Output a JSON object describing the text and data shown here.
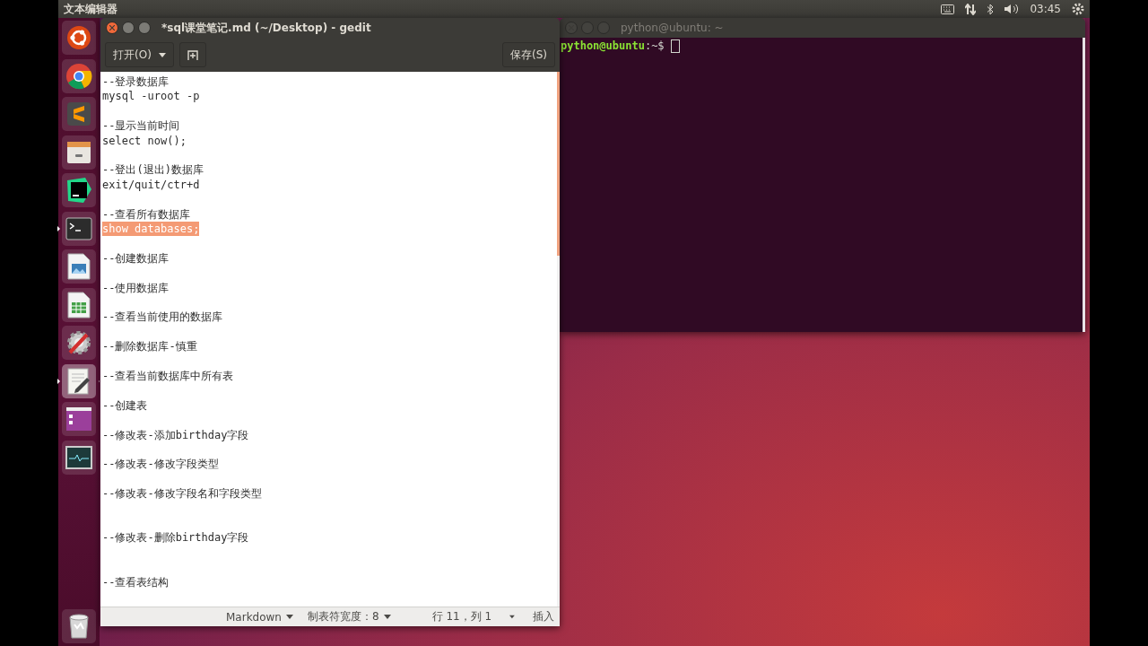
{
  "top_panel": {
    "app_title": "文本编辑器",
    "clock": "03:45"
  },
  "launcher": [
    {
      "kind": "ubuntu",
      "running": false,
      "focused": false
    },
    {
      "kind": "chrome",
      "running": false,
      "focused": false
    },
    {
      "kind": "sublime",
      "running": false,
      "focused": false
    },
    {
      "kind": "files",
      "running": false,
      "focused": false
    },
    {
      "kind": "pycharm",
      "running": false,
      "focused": false
    },
    {
      "kind": "terminal",
      "running": true,
      "focused": false
    },
    {
      "kind": "impress",
      "running": false,
      "focused": false
    },
    {
      "kind": "calc",
      "running": false,
      "focused": false
    },
    {
      "kind": "tools",
      "running": false,
      "focused": false
    },
    {
      "kind": "editor",
      "running": true,
      "focused": true
    },
    {
      "kind": "window",
      "running": false,
      "focused": false
    },
    {
      "kind": "monitor",
      "running": false,
      "focused": false
    },
    {
      "kind": "trash",
      "running": false,
      "focused": false
    }
  ],
  "editor_window": {
    "title": "*sql课堂笔记.md (~/Desktop) - gedit",
    "focused": true,
    "toolbar": {
      "open_button": "打开(O)",
      "save_button": "保存(S)"
    },
    "paragraphs": [
      {
        "spaced": false,
        "lines": [
          {
            "text": "--登录数据库",
            "selected": false
          },
          {
            "text": "mysql -uroot -p",
            "selected": false
          }
        ]
      },
      {
        "spaced": false,
        "lines": [
          {
            "text": "--显示当前时间",
            "selected": false
          },
          {
            "text": "select now();",
            "selected": false
          }
        ]
      },
      {
        "spaced": false,
        "lines": [
          {
            "text": "--登出(退出)数据库",
            "selected": false
          },
          {
            "text": "exit/quit/ctr+d",
            "selected": false
          }
        ]
      },
      {
        "spaced": false,
        "lines": [
          {
            "text": "--查看所有数据库",
            "selected": false
          },
          {
            "text": "show databases;",
            "selected": true
          }
        ]
      },
      {
        "spaced": false,
        "lines": [
          {
            "text": "--创建数据库",
            "selected": false
          }
        ]
      },
      {
        "spaced": false,
        "lines": [
          {
            "text": "--使用数据库",
            "selected": false
          }
        ]
      },
      {
        "spaced": false,
        "lines": [
          {
            "text": "--查看当前使用的数据库",
            "selected": false
          }
        ]
      },
      {
        "spaced": false,
        "lines": [
          {
            "text": "--删除数据库-慎重",
            "selected": false
          }
        ]
      },
      {
        "spaced": false,
        "lines": [
          {
            "text": "--查看当前数据库中所有表",
            "selected": false
          }
        ]
      },
      {
        "spaced": false,
        "lines": [
          {
            "text": "--创建表",
            "selected": false
          }
        ]
      },
      {
        "spaced": false,
        "lines": [
          {
            "text": "--修改表-添加birthday字段",
            "selected": false
          }
        ]
      },
      {
        "spaced": false,
        "lines": [
          {
            "text": "--修改表-修改字段类型",
            "selected": false
          }
        ]
      },
      {
        "spaced": false,
        "lines": [
          {
            "text": "--修改表-修改字段名和字段类型",
            "selected": false
          }
        ]
      },
      {
        "spaced": true,
        "lines": [
          {
            "text": "--修改表-删除birthday字段",
            "selected": false
          }
        ]
      },
      {
        "spaced": true,
        "lines": [
          {
            "text": "--查看表结构",
            "selected": false
          }
        ]
      }
    ],
    "status_bar": {
      "language": "Markdown",
      "tab_width": "制表符宽度：8",
      "position": "行 11，列 1",
      "mode": "插入"
    }
  },
  "terminal_window": {
    "title": "python@ubuntu: ~",
    "focused": false,
    "prompt_user": "python@ubuntu",
    "prompt_path": ":~$"
  }
}
